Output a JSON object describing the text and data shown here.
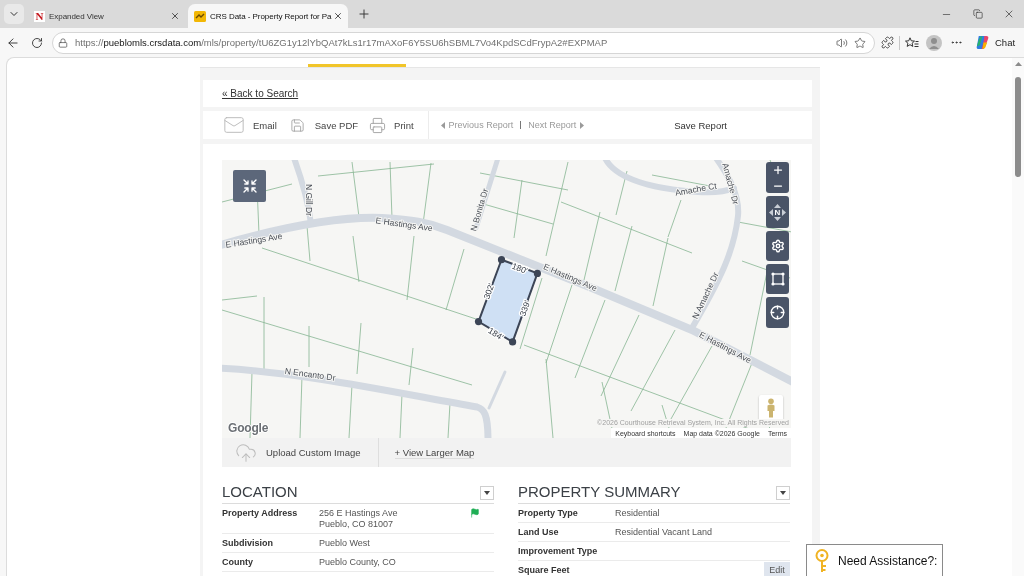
{
  "browser": {
    "tabs": [
      {
        "title": "Expanded View",
        "favicon_text": "N",
        "selected": false
      },
      {
        "title": "CRS Data - Property Report for Pa",
        "selected": true
      }
    ],
    "url": {
      "scheme": "https://",
      "domain": "pueblomls.crsdata.com",
      "path": "/mls/property/tU6ZG1y12lYbQAt7kLs1r17mAXoF6Y5SU6hSBML7Vo4KpdSCdFrypA2#EXPMAP"
    },
    "chat_label": "Chat"
  },
  "page": {
    "back_link": "« Back to Search",
    "toolbar": {
      "actions": [
        {
          "kind": "email",
          "label": "Email"
        },
        {
          "kind": "pdf",
          "label": "Save PDF"
        },
        {
          "kind": "print",
          "label": "Print"
        }
      ],
      "navigation": [
        {
          "kind": "previous",
          "label": "Previous Report",
          "disabled": true
        },
        {
          "kind": "next",
          "label": "Next Report",
          "disabled": true
        }
      ],
      "save": "Save Report"
    },
    "map": {
      "streets": [
        "N Gill Dr",
        "E Hastings Ave",
        "E Hastings Ave",
        "N Bonita Dr",
        "Amache Ct",
        "Amache Dr",
        "E Hastings Ave",
        "N Amache Dr",
        "E Hastings Ave",
        "N Encanto Dr"
      ],
      "parcel_sides": [
        "180'",
        "339'",
        "184'",
        "302'"
      ],
      "compass_label": "N",
      "google_logo": "Google",
      "copyright": "©2026 Courthouse Retrieval System, Inc. All Rights Reserved",
      "links": [
        "Keyboard shortcuts",
        "Map data ©2026 Google",
        "Terms"
      ]
    },
    "map_actions": {
      "upload": "Upload Custom Image",
      "larger_map": "+ View Larger Map"
    },
    "sections": [
      {
        "title": "LOCATION",
        "rows": [
          {
            "label": "Property Address",
            "value": [
              "256 E Hastings Ave",
              "Pueblo, CO 81007"
            ],
            "flagged": true
          },
          {
            "label": "Subdivision",
            "value": [
              "Pueblo West"
            ],
            "flagged": false
          },
          {
            "label": "County",
            "value": [
              "Pueblo County, CO"
            ],
            "flagged": false
          }
        ]
      },
      {
        "title": "PROPERTY SUMMARY",
        "rows": [
          {
            "label": "Property Type",
            "value": [
              "Residential"
            ]
          },
          {
            "label": "Land Use",
            "value": [
              "Residential Vacant Land"
            ]
          },
          {
            "label": "Improvement Type"
          },
          {
            "label": "Square Feet",
            "action": "Edit"
          }
        ]
      }
    ]
  },
  "assistance": {
    "label": "Need Assistance?:"
  }
}
